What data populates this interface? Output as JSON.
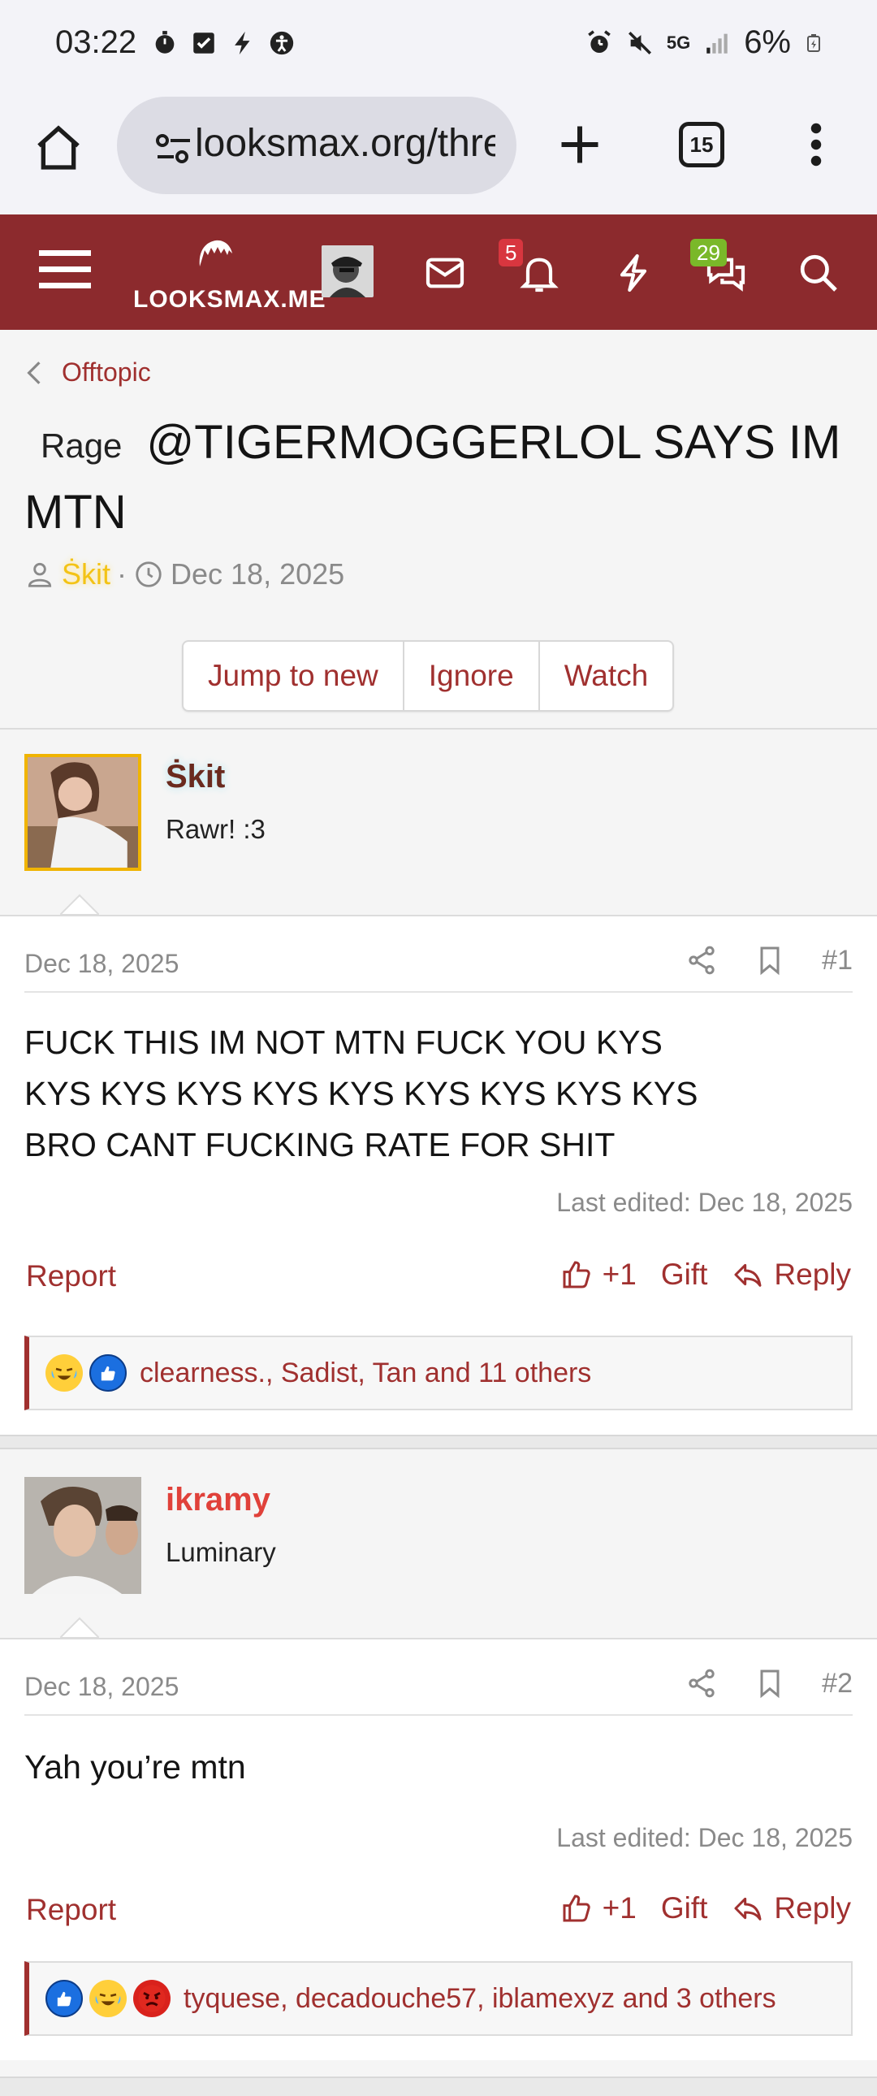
{
  "status_bar": {
    "time": "03:22",
    "network": "5G",
    "battery": "6%",
    "icons_left": [
      "timer-icon",
      "checkbox-icon",
      "bolt-icon",
      "accessibility-icon"
    ],
    "icons_right": [
      "alarm-icon",
      "mute-icon",
      "signal-icon",
      "battery-icon"
    ]
  },
  "browser": {
    "url": "looksmax.org/threads",
    "tab_count": "15"
  },
  "site_header": {
    "logo_text": "LOOKSMAX.ME",
    "notifications_badge": "5",
    "conversations_badge": "29",
    "accent_color": "#8c2a2d"
  },
  "breadcrumb": {
    "label": "Offtopic"
  },
  "thread": {
    "prefix": "Rage",
    "title": "@TIGERMOGGERLOL SAYS IM MTN",
    "author": "Ṡkit",
    "date": "Dec 18, 2025",
    "buttons": {
      "jump_to_new": "Jump to new",
      "ignore": "Ignore",
      "watch": "Watch"
    }
  },
  "posts": [
    {
      "username": "Ṡkit",
      "username_color": "#6a2a1e",
      "user_title": "Rawr! :3",
      "date": "Dec 18, 2025",
      "number": "#1",
      "lines": [
        "FUCK THIS IM NOT MTN FUCK YOU KYS",
        "KYS KYS KYS KYS KYS KYS KYS KYS KYS",
        "BRO CANT FUCKING RATE FOR SHIT"
      ],
      "last_edited": "Last edited: Dec 18, 2025",
      "report": "Report",
      "like_count": "+1",
      "gift": "Gift",
      "reply": "Reply",
      "reactions": [
        "crying-laughing-icon",
        "thumbs-up-icon"
      ],
      "reactions_text": "clearness., Sadist, Tan and 11 others"
    },
    {
      "username": "ikramy",
      "username_color": "#e0413a",
      "user_title": "Luminary",
      "date": "Dec 18, 2025",
      "number": "#2",
      "lines": [
        "Yah you’re mtn"
      ],
      "last_edited": "Last edited: Dec 18, 2025",
      "report": "Report",
      "like_count": "+1",
      "gift": "Gift",
      "reply": "Reply",
      "reactions": [
        "thumbs-up-icon",
        "crying-laughing-icon",
        "angry-face-icon"
      ],
      "reactions_text": "tyquese, decadouche57, iblamexyz and 3 others"
    }
  ]
}
